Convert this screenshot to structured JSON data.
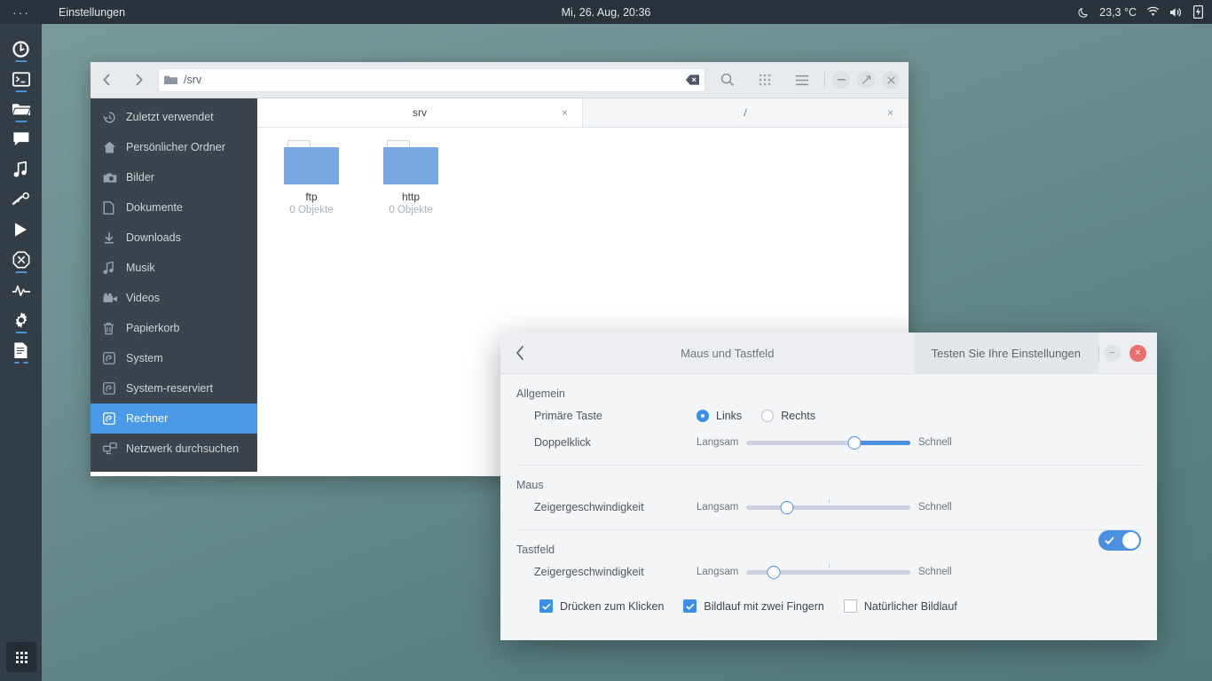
{
  "panel": {
    "menu_glyph": "···",
    "app_name": "Einstellungen",
    "clock": "Mi, 26. Aug, 20:36",
    "temperature": "23,3 °C",
    "icons": [
      "moon-icon",
      "wifi-icon",
      "volume-icon",
      "battery-icon"
    ]
  },
  "dock": {
    "items": [
      {
        "name": "browser",
        "icon": "browser-icon",
        "running": true
      },
      {
        "name": "terminal",
        "icon": "terminal-icon",
        "running": true
      },
      {
        "name": "files",
        "icon": "files-icon",
        "running": true
      },
      {
        "name": "chat",
        "icon": "chat-icon",
        "running": false
      },
      {
        "name": "music",
        "icon": "music-note-icon",
        "running": false
      },
      {
        "name": "tools",
        "icon": "wrench-icon",
        "running": false
      },
      {
        "name": "player",
        "icon": "play-icon",
        "running": false
      },
      {
        "name": "blocker",
        "icon": "blocked-icon",
        "running": true
      },
      {
        "name": "monitor",
        "icon": "pulse-icon",
        "running": false
      },
      {
        "name": "settings",
        "icon": "gear-icon",
        "running": true
      },
      {
        "name": "documents",
        "icon": "document-icon",
        "running": true
      }
    ],
    "apps_button": "apps-grid-icon"
  },
  "filemanager": {
    "path": "/srv",
    "path_icon": "folder-icon",
    "nav": {
      "back": "back-arrow-icon",
      "forward": "forward-arrow-icon"
    },
    "clear_icon": "backspace-clear-icon",
    "tools": [
      "search-icon",
      "view-grid-icon",
      "menu-icon"
    ],
    "window_buttons": [
      "minimize",
      "maximize",
      "close"
    ],
    "sidebar": [
      {
        "label": "Zuletzt verwendet",
        "icon": "history-icon",
        "active": false
      },
      {
        "label": "Persönlicher Ordner",
        "icon": "home-icon",
        "active": false
      },
      {
        "label": "Bilder",
        "icon": "camera-icon",
        "active": false
      },
      {
        "label": "Dokumente",
        "icon": "document-icon",
        "active": false
      },
      {
        "label": "Downloads",
        "icon": "download-icon",
        "active": false
      },
      {
        "label": "Musik",
        "icon": "music-note-icon",
        "active": false
      },
      {
        "label": "Videos",
        "icon": "video-camera-icon",
        "active": false
      },
      {
        "label": "Papierkorb",
        "icon": "trash-icon",
        "active": false
      },
      {
        "label": "System",
        "icon": "drive-icon",
        "active": false
      },
      {
        "label": "System-reserviert",
        "icon": "drive-icon",
        "active": false
      },
      {
        "label": "Rechner",
        "icon": "drive-icon",
        "active": true
      },
      {
        "label": "Netzwerk durchsuchen",
        "icon": "network-icon",
        "active": false
      }
    ],
    "tabs": [
      {
        "label": "srv",
        "active": true,
        "close": "×"
      },
      {
        "label": "/",
        "active": false,
        "close": "×"
      }
    ],
    "files": [
      {
        "name": "ftp",
        "sub": "0 Objekte",
        "icon": "folder-icon"
      },
      {
        "name": "http",
        "sub": "0 Objekte",
        "icon": "folder-icon"
      }
    ]
  },
  "settings": {
    "back_icon": "back-chevron-icon",
    "title": "Maus und Tastfeld",
    "test_button": "Testen Sie Ihre Einstellungen",
    "window_buttons": {
      "minimize": "−",
      "close": "×"
    },
    "sections": {
      "general": {
        "title": "Allgemein",
        "primary_button": {
          "label": "Primäre Taste",
          "options": [
            {
              "label": "Links",
              "selected": true
            },
            {
              "label": "Rechts",
              "selected": false
            }
          ]
        },
        "double_click": {
          "label": "Doppelklick",
          "min_label": "Langsam",
          "max_label": "Schnell",
          "value_pct": 66
        }
      },
      "mouse": {
        "title": "Maus",
        "pointer_speed": {
          "label": "Zeigergeschwindigkeit",
          "min_label": "Langsam",
          "max_label": "Schnell",
          "value_pct": 25
        }
      },
      "touchpad": {
        "title": "Tastfeld",
        "enabled": true,
        "pointer_speed": {
          "label": "Zeigergeschwindigkeit",
          "min_label": "Langsam",
          "max_label": "Schnell",
          "value_pct": 17
        },
        "checkboxes": [
          {
            "label": "Drücken zum Klicken",
            "checked": true
          },
          {
            "label": "Bildlauf mit zwei Fingern",
            "checked": true
          },
          {
            "label": "Natürlicher Bildlauf",
            "checked": false
          }
        ]
      }
    }
  },
  "colors": {
    "accent_blue": "#4a8fe0",
    "sidebar_active": "#4a9ae8",
    "close_red": "#ec6d6d",
    "panel_dark": "#2b323b",
    "dock_dark": "#333d47",
    "folder_blue": "#78a8e0"
  }
}
